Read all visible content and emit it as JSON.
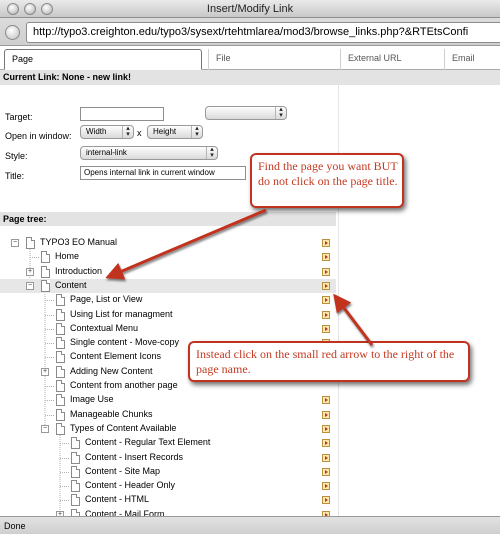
{
  "window": {
    "title": "Insert/Modify Link"
  },
  "address": {
    "url": "http://typo3.creighton.edu/typo3/sysext/rtehtmlarea/mod3/browse_links.php?&RTEtsConfi"
  },
  "tabs": [
    "Page",
    "File",
    "External URL",
    "Email"
  ],
  "current_link": "Current Link: None - new link!",
  "form": {
    "target_label": "Target:",
    "target_value": "",
    "target_select": "",
    "open_label": "Open in window:",
    "width_select": "Width",
    "times": "x",
    "height_select": "Height",
    "style_label": "Style:",
    "style_select": "internal-link",
    "title_label": "Title:",
    "title_value": "Opens internal link in current window"
  },
  "tree_heading": "Page tree:",
  "tree": [
    {
      "label": "TYPO3 EO Manual",
      "level": 0,
      "toggle": "minus",
      "arrow": true
    },
    {
      "label": "Home",
      "level": 1,
      "toggle": "",
      "arrow": true
    },
    {
      "label": "Introduction",
      "level": 1,
      "toggle": "plus",
      "arrow": true
    },
    {
      "label": "Content",
      "level": 1,
      "toggle": "minus",
      "arrow": true,
      "highlight": true
    },
    {
      "label": "Page, List or View",
      "level": 2,
      "toggle": "",
      "arrow": true
    },
    {
      "label": "Using List for managment",
      "level": 2,
      "toggle": "",
      "arrow": true
    },
    {
      "label": "Contextual Menu",
      "level": 2,
      "toggle": "",
      "arrow": true
    },
    {
      "label": "Single content - Move-copy",
      "level": 2,
      "toggle": "",
      "arrow": true
    },
    {
      "label": "Content Element Icons",
      "level": 2,
      "toggle": "",
      "arrow": false
    },
    {
      "label": "Adding New Content",
      "level": 2,
      "toggle": "plus",
      "arrow": false
    },
    {
      "label": "Content from another page",
      "level": 2,
      "toggle": "",
      "arrow": false
    },
    {
      "label": "Image Use",
      "level": 2,
      "toggle": "",
      "arrow": true
    },
    {
      "label": "Manageable Chunks",
      "level": 2,
      "toggle": "",
      "arrow": true
    },
    {
      "label": "Types of Content Available",
      "level": 2,
      "toggle": "minus",
      "arrow": true
    },
    {
      "label": "Content - Regular Text Element",
      "level": 3,
      "toggle": "",
      "arrow": true
    },
    {
      "label": "Content - Insert Records",
      "level": 3,
      "toggle": "",
      "arrow": true
    },
    {
      "label": "Content - Site Map",
      "level": 3,
      "toggle": "",
      "arrow": true
    },
    {
      "label": "Content - Header Only",
      "level": 3,
      "toggle": "",
      "arrow": true
    },
    {
      "label": "Content - HTML",
      "level": 3,
      "toggle": "",
      "arrow": true
    },
    {
      "label": "Content - Mail Form",
      "level": 3,
      "toggle": "plus",
      "arrow": true
    }
  ],
  "callouts": {
    "first": "Find the page you want BUT do not click on the page title.",
    "second": "Instead click on the small red arrow to the right of the page name."
  },
  "status": "Done",
  "colors": {
    "callout_border": "#c2331f",
    "callout_text": "#c43a22",
    "tree_arrow": "#b33"
  }
}
